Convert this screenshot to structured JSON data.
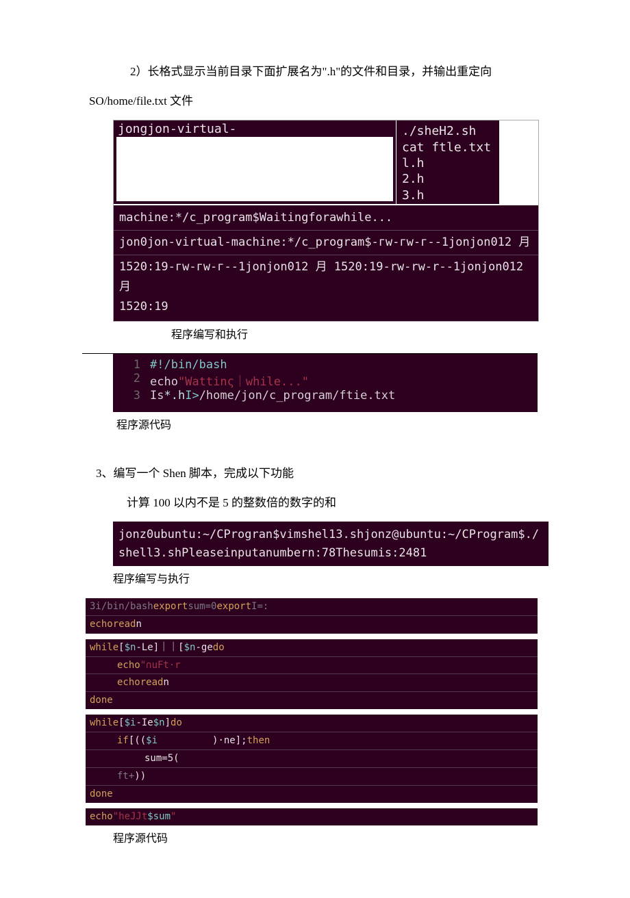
{
  "text": {
    "q2_title": "2）长格式显示当前目录下面扩展名为\".h\"的文件和目录，并输出重定向",
    "q2_sub": "SO/home/file.txt 文件",
    "cap_exec1": "程序编写和执行",
    "cap_src1": "程序源代码",
    "q3_title": "3、编写一个 Shen 脚本，完成以下功能",
    "q3_sub": "计算 100 以内不是 5 的整数倍的数字的和",
    "cap_exec2": "程序编写与执行",
    "cap_src2": "程序源代码"
  },
  "term1": {
    "top_left": "jongjon-virtual-",
    "right": {
      "l1": "./sheH2.sh",
      "l2": "",
      "l3": "cat ftle.txt",
      "l4": "l.h",
      "l5": "2.h",
      "l6": "3.h"
    },
    "bot1": "machine:*/c_program$Waitingforawhile...",
    "bot2": "jon0jon-virtual-machine:*/c_program$-гw-гw-г--1jonjon012  月",
    "bot3": "1520:19-гw-гw-г--1jonjon012 月 1520:19-rw-rw-r--1jonjon012 月",
    "bot4": "1520:19"
  },
  "editor": {
    "l1": {
      "n": "1",
      "shebang": "#!/bin/bash"
    },
    "l2": {
      "n": "2",
      "cmd": "echo",
      "q1": "\"",
      "str": "Wattinς｜while...",
      "q2": "\""
    },
    "l3": {
      "n": "3",
      "cmd": "Is",
      "glob": "*.h",
      "op": "I>",
      "path": "/home/jon/c_program/ftie.txt"
    }
  },
  "term2": {
    "l1": "jonz0ubuntu:~/CProgran$vimshel13.shjonz@ubuntu:~/CProgram$./",
    "l2": "shell3.shPleaseinputanumbern:78Thesumis:2481"
  },
  "script": {
    "r1": {
      "a": "3i/",
      "b": "bin/",
      "c": "bash",
      "d": "export",
      "e": "sum=0",
      "f": "export",
      "g": "I=:"
    },
    "r2": {
      "a": "echo",
      "b": "read",
      "c": "n"
    },
    "r3": {
      "a": "while",
      "b": "[",
      "c": "$n",
      "d": "-Le",
      "e": "]｜｜[",
      "f": "$n",
      "g": "-ge",
      "h": "do"
    },
    "r3a": {
      "a": "echo",
      "b": "\"∩uFt·r"
    },
    "r3b": {
      "a": "echo",
      "b": "read",
      "c": "n"
    },
    "r3d": "done",
    "r4": {
      "a": "while",
      "b": "[",
      "c": "$i",
      "d": "-Ie",
      "e": "$n",
      "f": "]",
      "g": "do"
    },
    "r4a": {
      "a": "if",
      "b": "[((",
      "c": "$i",
      "d": ")·ne];",
      "e": "then"
    },
    "r4b": {
      "a": "sum=5("
    },
    "r4c": {
      "a": "ft+",
      "b": "))"
    },
    "r4d": "done",
    "r5": {
      "a": "echo",
      "b": "\"heJJt",
      "c": "$sum",
      "d": "\""
    }
  }
}
